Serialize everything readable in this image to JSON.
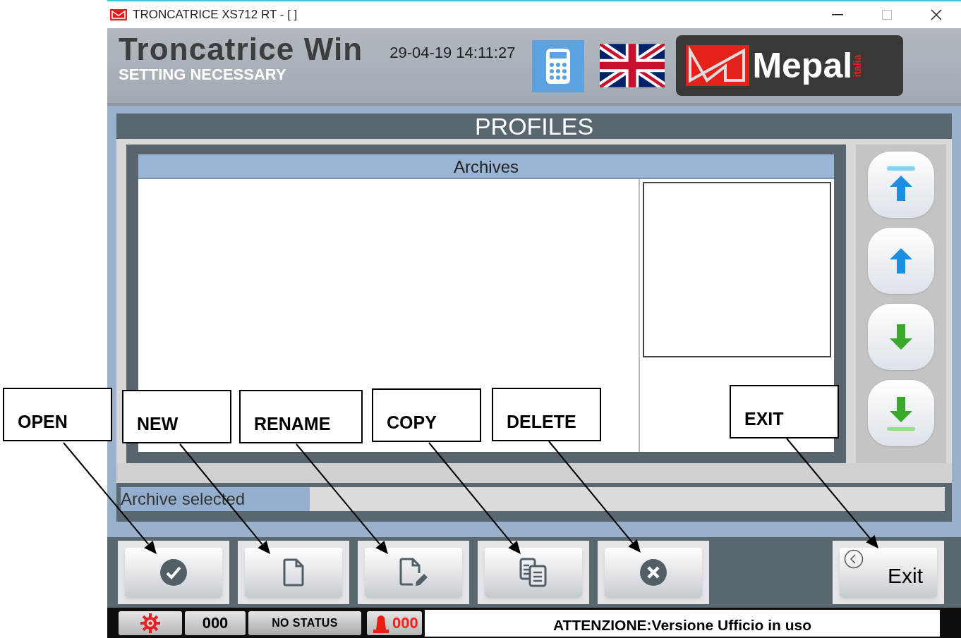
{
  "window": {
    "title": "TRONCATRICE XS712 RT - [ ]"
  },
  "header": {
    "title": "Troncatrice Win",
    "subtitle": "SETTING NECESSARY",
    "datetime": "29-04-19 14:11:27",
    "logo": "Mepal",
    "logo_sub": "italia"
  },
  "panel": {
    "title": "PROFILES",
    "list_header": "Archives",
    "selected_label": "Archive selected"
  },
  "scroll_buttons": [
    {
      "kind": "top"
    },
    {
      "kind": "up"
    },
    {
      "kind": "down"
    },
    {
      "kind": "bottom"
    }
  ],
  "actions": [
    {
      "kind": "open"
    },
    {
      "kind": "new"
    },
    {
      "kind": "rename"
    },
    {
      "kind": "copy"
    },
    {
      "kind": "delete"
    },
    {
      "kind": "exit",
      "label": "Exit"
    }
  ],
  "status_bar": {
    "counter": "000",
    "status": "NO STATUS",
    "alarms": "000",
    "message": "ATTENZIONE:Versione Ufficio in uso"
  },
  "callouts": [
    {
      "label": "OPEN"
    },
    {
      "label": "NEW"
    },
    {
      "label": "RENAME"
    },
    {
      "label": "COPY"
    },
    {
      "label": "DELETE"
    },
    {
      "label": "EXIT"
    }
  ]
}
